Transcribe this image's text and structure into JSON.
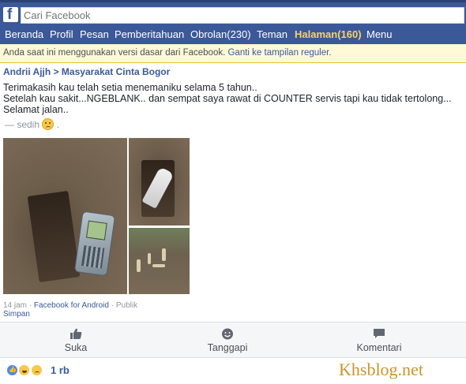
{
  "search": {
    "placeholder": "Cari Facebook"
  },
  "nav": {
    "items": [
      {
        "label": "Beranda"
      },
      {
        "label": "Profil"
      },
      {
        "label": "Pesan"
      },
      {
        "label": "Pemberitahuan"
      },
      {
        "label": "Obrolan(230)"
      },
      {
        "label": "Teman"
      },
      {
        "label": "Halaman(160)"
      },
      {
        "label": "Menu"
      }
    ]
  },
  "notice": {
    "text": "Anda saat ini menggunakan versi dasar dari Facebook.",
    "link": "Ganti ke tampilan reguler."
  },
  "post": {
    "author": "Andrii Ajjh",
    "separator": ">",
    "group": "Masyarakat Cinta Bogor",
    "lines": [
      "Terimakasih kau telah setia menemaniku selama 5 tahun..",
      "Setelah kau sakit...NGEBLANK.. dan sempat saya rawat di COUNTER servis tapi kau tidak tertolong...",
      "Selamat jalan.."
    ],
    "feeling_prefix": "— sedih",
    "feeling_suffix": ".",
    "time": "14 jam",
    "dot1": " · ",
    "app": "Facebook for Android",
    "dot2": " · ",
    "privacy": "Publik",
    "save": "Simpan"
  },
  "actions": {
    "like": "Suka",
    "react": "Tanggapi",
    "comment": "Komentari"
  },
  "reactions": {
    "count": "1 rb"
  },
  "watermark": "Khsblog.net",
  "colors": {
    "brand": "#3b5998",
    "highlight": "#f7d36a",
    "notice_bg": "#fff9d7"
  }
}
